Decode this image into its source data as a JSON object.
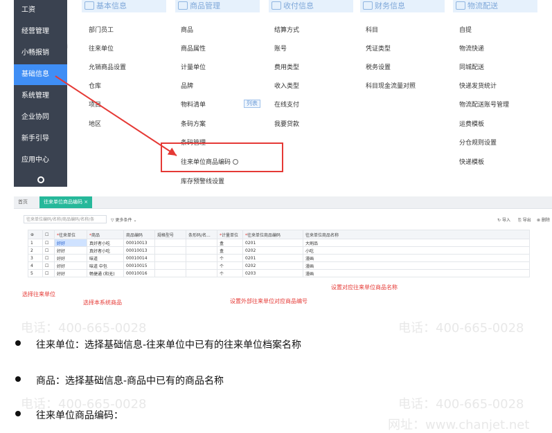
{
  "sidebar": {
    "items": [
      "工资",
      "经营管理",
      "小畅报销",
      "基础信息",
      "系统管理",
      "企业协同",
      "新手引导",
      "应用中心"
    ],
    "active_index": 3
  },
  "menu": {
    "categories": [
      {
        "title": "基本信息",
        "icon": "grid-icon",
        "items": [
          "部门员工",
          "往来单位",
          "允销商品设置",
          "仓库",
          "项目",
          "地区"
        ]
      },
      {
        "title": "商品管理",
        "icon": "cube-icon",
        "items": [
          "商品",
          "商品属性",
          "计量单位",
          "品牌",
          "物料清单",
          "条码方案",
          "条码管理",
          "往来单位商品编码",
          "库存预警线设置"
        ],
        "badge": "列表"
      },
      {
        "title": "收付信息",
        "icon": "payment-icon",
        "items": [
          "结算方式",
          "账号",
          "费用类型",
          "收入类型",
          "在线支付",
          "我要贷款"
        ]
      },
      {
        "title": "财务信息",
        "icon": "finance-icon",
        "items": [
          "科目",
          "凭证类型",
          "税务设置",
          "科目现金流量对照"
        ]
      },
      {
        "title": "物流配送",
        "icon": "truck-icon",
        "items": [
          "自提",
          "物流快递",
          "同城配送",
          "快递发货统计",
          "物流配送账号管理",
          "运费模板",
          "分仓规则设置",
          "快递模板"
        ]
      }
    ]
  },
  "table_panel": {
    "tab_home": "首页",
    "tab_active": "往来单位商品编码",
    "search_placeholder": "往来单位编码/名称/商品编码/名称/条",
    "filter_label": "更多条件",
    "tools": [
      "导入",
      "导出",
      "删除"
    ],
    "headers": [
      "",
      "",
      "往来单位",
      "商品",
      "商品编码",
      "规格型号",
      "条形码/名...",
      "计量单位",
      "往来单位商品编码",
      "往来单位商品名称"
    ],
    "rows": [
      [
        "1",
        "",
        "好好",
        "真好者小吃",
        "00010013",
        "",
        "",
        "盒",
        "0201",
        "大刷品"
      ],
      [
        "2",
        "",
        "好好",
        "真好者小吃",
        "00010013",
        "",
        "",
        "盒",
        "0202",
        "小吃"
      ],
      [
        "3",
        "",
        "好好",
        "味道",
        "00010014",
        "",
        "",
        "个",
        "0201",
        "漫画"
      ],
      [
        "4",
        "",
        "好好",
        "味道 中包",
        "00010015",
        "",
        "",
        "个",
        "0202",
        "漫画"
      ],
      [
        "5",
        "",
        "好好",
        "畅捷通 (和无)",
        "00010016",
        "",
        "",
        "个",
        "0203",
        "漫画"
      ]
    ],
    "annotations": [
      "选择往来单位",
      "选择本系统商品",
      "设置外部往来单位对应商品编号",
      "设置对应往来单位商品名称"
    ]
  },
  "bullets": [
    "往来单位：选择基础信息-往来单位中已有的往来单位档案名称",
    "商品：选择基础信息-商品中已有的商品名称",
    "往来单位商品编码："
  ],
  "watermarks": [
    "电话：400-665-0028",
    "网址：www.chanjet.net"
  ],
  "colors": {
    "sidebar": "#3a4250",
    "active": "#3f8ef5",
    "tab": "#26b89a",
    "highlight": "#e53935"
  }
}
